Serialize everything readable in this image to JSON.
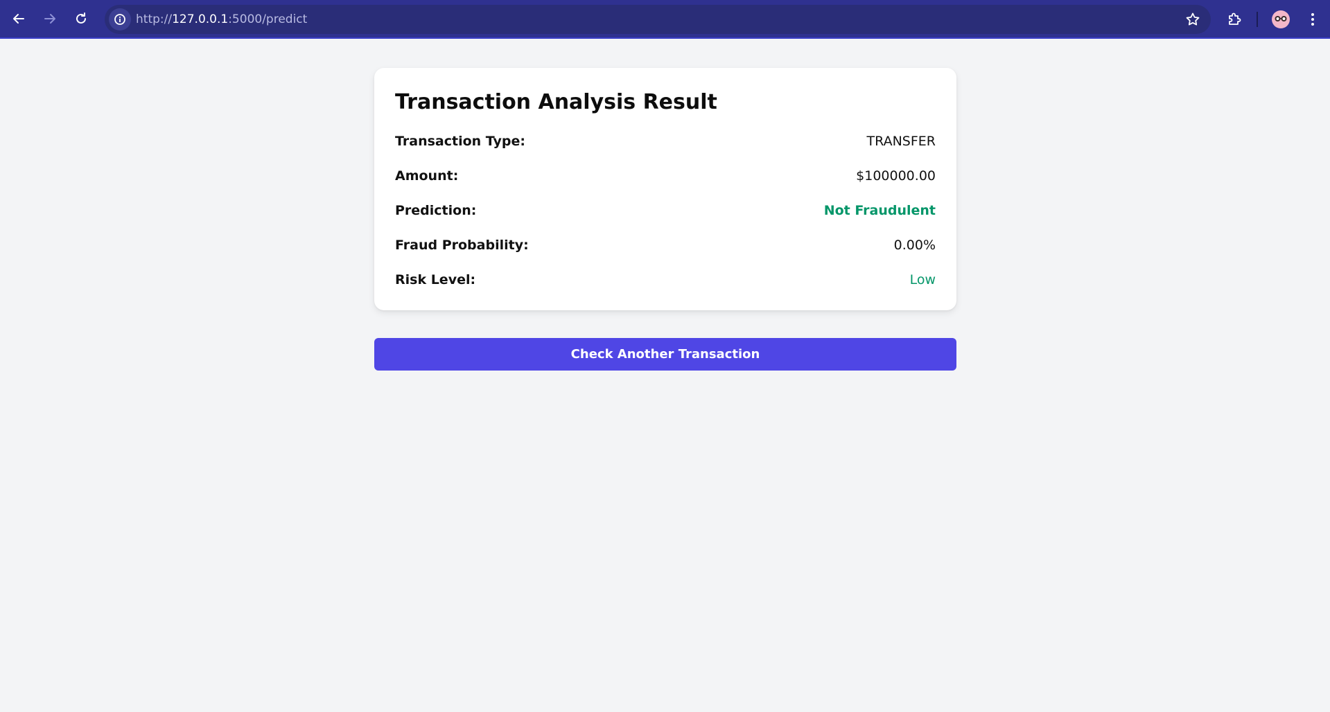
{
  "browser": {
    "url_scheme": "http://",
    "url_host": "127.0.0.1",
    "url_rest": ":5000/predict",
    "icons": {
      "back": "back-arrow-icon",
      "forward": "forward-arrow-icon",
      "reload": "reload-icon",
      "site_info": "info-icon",
      "bookmark": "star-icon",
      "extensions": "puzzle-icon",
      "profile": "avatar",
      "menu": "kebab-menu-icon"
    }
  },
  "result": {
    "title": "Transaction Analysis Result",
    "rows": [
      {
        "label": "Transaction Type:",
        "value": "TRANSFER"
      },
      {
        "label": "Amount:",
        "value": "$100000.00"
      },
      {
        "label": "Prediction:",
        "value": "Not Fraudulent"
      },
      {
        "label": "Fraud Probability:",
        "value": "0.00%"
      },
      {
        "label": "Risk Level:",
        "value": "Low"
      }
    ]
  },
  "actions": {
    "check_another_label": "Check Another Transaction"
  },
  "colors": {
    "toolbar": "#2f3190",
    "page_bg": "#f3f4f6",
    "accent_button": "#4f46e5",
    "safe_green": "#059669"
  }
}
